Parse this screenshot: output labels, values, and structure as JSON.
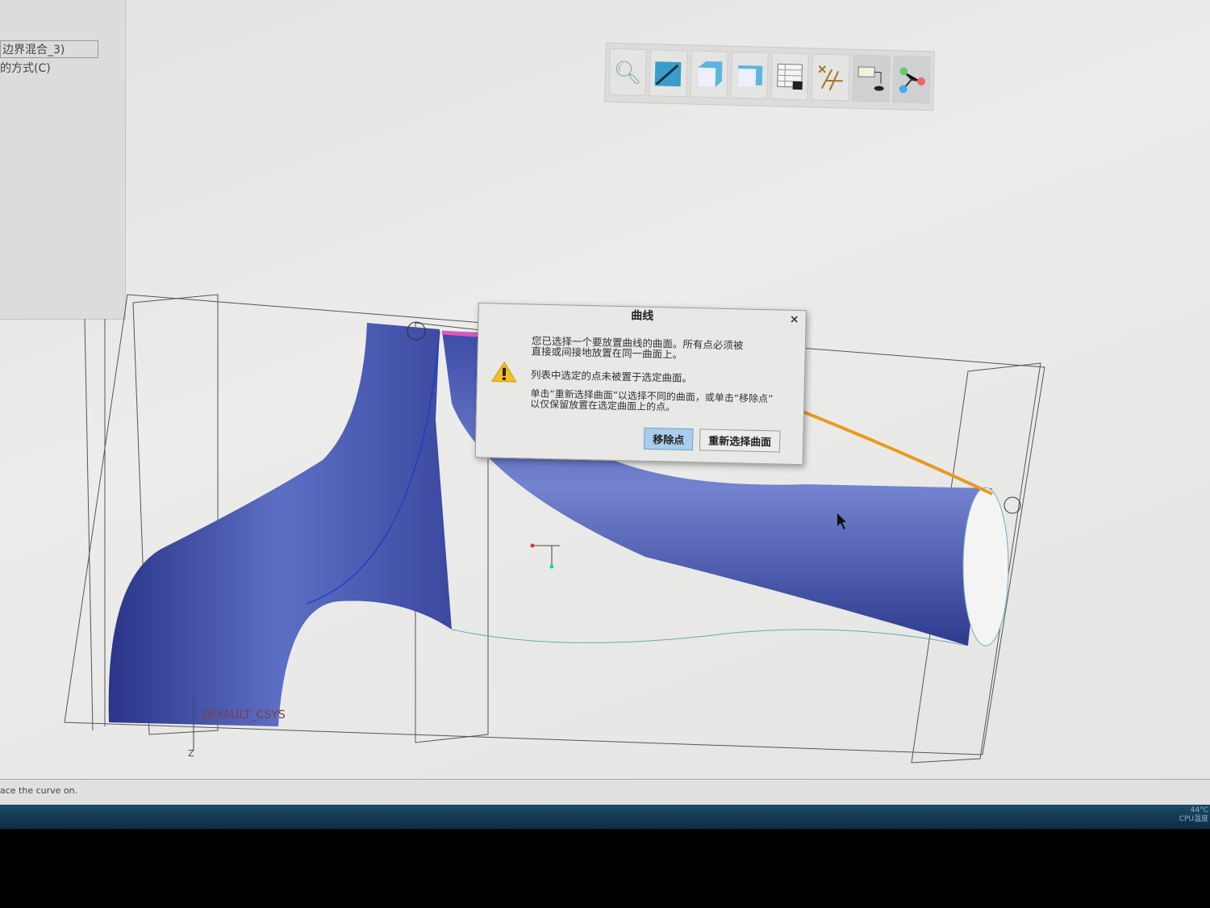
{
  "left_panel": {
    "feature_name": "边界混合_3)",
    "method_label": "的方式(C)"
  },
  "toolbar": {
    "icons": [
      "zoom-icon",
      "shaded-edges-icon",
      "display-style-icon",
      "saved-views-icon",
      "view-manager-icon",
      "datum-display-icon",
      "annotation-display-icon",
      "spin-center-icon"
    ]
  },
  "viewport": {
    "csys_label": "DEFAULT_CSYS",
    "axis_label": "Z",
    "model_color": "#4a5bb0",
    "curve_color": "#e89a1e"
  },
  "dialog": {
    "title": "曲线",
    "close": "×",
    "message1_line1": "您已选择一个要放置曲线的曲面。所有点必须被",
    "message1_line2": "直接或间接地放置在同一曲面上。",
    "message2": "列表中选定的点未被置于选定曲面。",
    "message3_line1": "单击“重新选择曲面”以选择不同的曲面，或单击“移除点”",
    "message3_line2": "以仅保留放置在选定曲面上的点。",
    "remove_points": "移除点",
    "reselect_surface": "重新选择曲面"
  },
  "status": {
    "message": "ace the curve on."
  },
  "taskbar": {
    "temp": "44°C",
    "cpu": "CPU温度"
  }
}
